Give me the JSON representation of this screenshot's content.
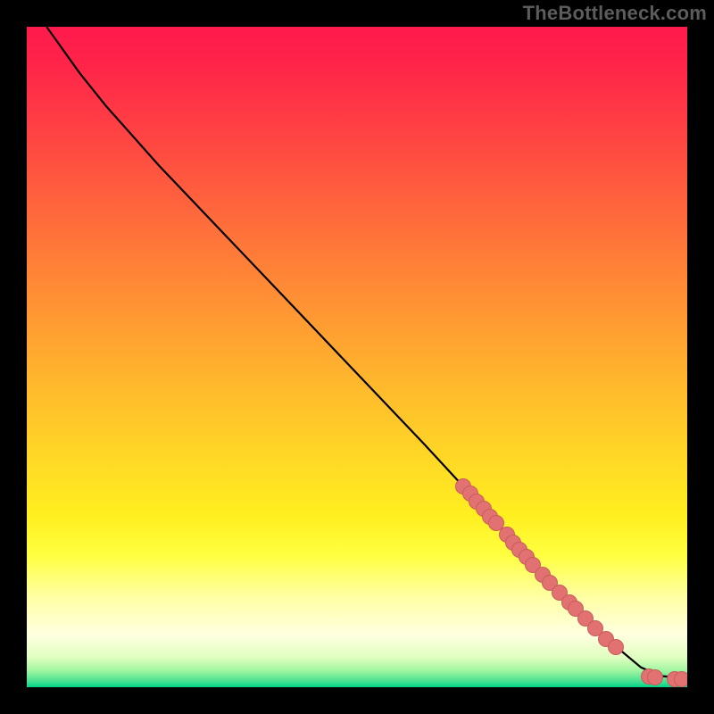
{
  "watermark": "TheBottleneck.com",
  "gradient_stops": [
    {
      "offset": 0.0,
      "color": "#ff1a4d"
    },
    {
      "offset": 0.06,
      "color": "#ff2549"
    },
    {
      "offset": 0.15,
      "color": "#ff3f44"
    },
    {
      "offset": 0.25,
      "color": "#ff5e3e"
    },
    {
      "offset": 0.35,
      "color": "#ff7d38"
    },
    {
      "offset": 0.45,
      "color": "#ff9c32"
    },
    {
      "offset": 0.55,
      "color": "#ffbb2c"
    },
    {
      "offset": 0.65,
      "color": "#ffd726"
    },
    {
      "offset": 0.74,
      "color": "#ffef20"
    },
    {
      "offset": 0.8,
      "color": "#ffff40"
    },
    {
      "offset": 0.86,
      "color": "#ffffa0"
    },
    {
      "offset": 0.92,
      "color": "#ffffe0"
    },
    {
      "offset": 0.955,
      "color": "#e0ffc0"
    },
    {
      "offset": 0.975,
      "color": "#a0f5a0"
    },
    {
      "offset": 0.992,
      "color": "#40e090"
    },
    {
      "offset": 1.0,
      "color": "#00d488"
    }
  ],
  "chart_data": {
    "type": "line",
    "title": "",
    "xlabel": "",
    "ylabel": "",
    "xlim": [
      0,
      100
    ],
    "ylim": [
      0,
      100
    ],
    "series": [
      {
        "name": "curve",
        "x": [
          3,
          8,
          12,
          20,
          30,
          40,
          50,
          60,
          66,
          70,
          74,
          78,
          82,
          85,
          88,
          90,
          93,
          96,
          99
        ],
        "y": [
          100,
          93,
          88,
          79,
          68.5,
          58,
          47.5,
          37,
          30.5,
          26,
          22,
          17.5,
          13,
          10,
          7,
          5.5,
          3,
          1.7,
          1.4
        ]
      }
    ],
    "scatter_points": [
      {
        "x": 66,
        "y": 30.5
      },
      {
        "x": 67,
        "y": 29.5
      },
      {
        "x": 68,
        "y": 28.3
      },
      {
        "x": 69,
        "y": 27.2
      },
      {
        "x": 70,
        "y": 26.0
      },
      {
        "x": 71,
        "y": 25.0
      },
      {
        "x": 72.5,
        "y": 23.2
      },
      {
        "x": 73.5,
        "y": 22.0
      },
      {
        "x": 74.5,
        "y": 21.0
      },
      {
        "x": 75.5,
        "y": 19.8
      },
      {
        "x": 76.5,
        "y": 18.7
      },
      {
        "x": 78,
        "y": 17.2
      },
      {
        "x": 79,
        "y": 16.0
      },
      {
        "x": 80.5,
        "y": 14.5
      },
      {
        "x": 82,
        "y": 13.0
      },
      {
        "x": 83,
        "y": 12.0
      },
      {
        "x": 84.5,
        "y": 10.5
      },
      {
        "x": 86,
        "y": 9.0
      },
      {
        "x": 87.5,
        "y": 7.5
      },
      {
        "x": 89,
        "y": 6.2
      },
      {
        "x": 94,
        "y": 1.7
      },
      {
        "x": 95,
        "y": 1.6
      },
      {
        "x": 98,
        "y": 1.4
      },
      {
        "x": 99,
        "y": 1.4
      }
    ],
    "dot_color": "#e27272",
    "line_color": "#000000"
  }
}
